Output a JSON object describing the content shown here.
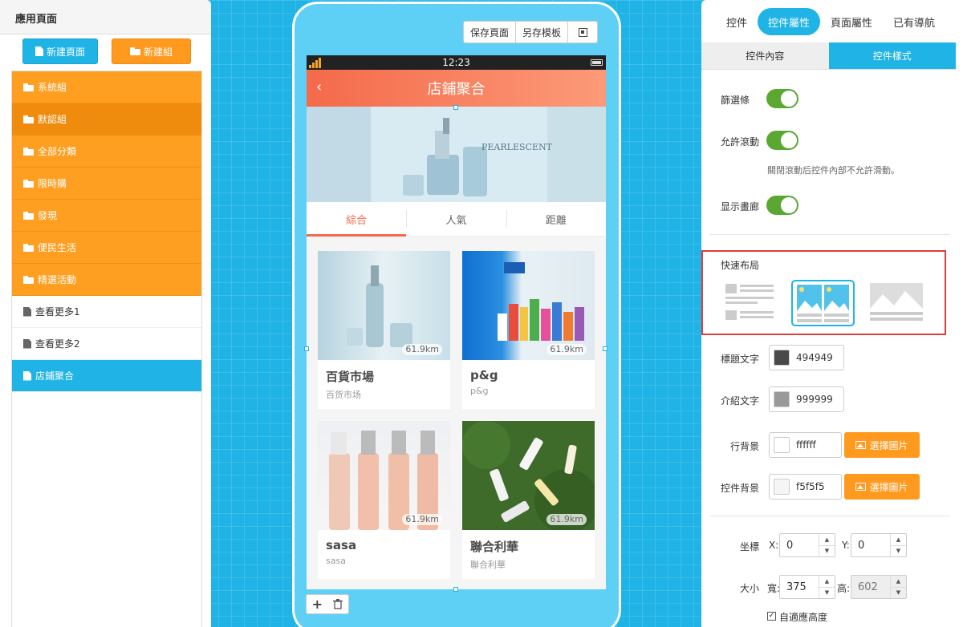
{
  "left": {
    "title": "應用頁面",
    "new_page": "新建頁面",
    "new_group": "新建組",
    "items": [
      {
        "label": "系統組",
        "type": "group"
      },
      {
        "label": "默認組",
        "type": "group"
      },
      {
        "label": "全部分類",
        "type": "group"
      },
      {
        "label": "限時購",
        "type": "group"
      },
      {
        "label": "發現",
        "type": "group"
      },
      {
        "label": "便民生活",
        "type": "group"
      },
      {
        "label": "精選活動",
        "type": "group"
      },
      {
        "label": "查看更多1",
        "type": "page"
      },
      {
        "label": "查看更多2",
        "type": "page"
      },
      {
        "label": "店鋪聚合",
        "type": "page"
      }
    ]
  },
  "toolbar": {
    "save": "保存頁面",
    "save_template": "另存模板",
    "qr_icon": "qrcode-icon"
  },
  "phone": {
    "time": "12:23",
    "title": "店鋪聚合",
    "back": "‹",
    "tabs": [
      "綜合",
      "人氣",
      "距離"
    ],
    "stores": [
      {
        "title": "百貨市場",
        "sub": "百货市场",
        "dist": "61.9km"
      },
      {
        "title": "p&g",
        "sub": "p&g",
        "dist": "61.9km"
      },
      {
        "title": "sasa",
        "sub": "sasa",
        "dist": "61.9km"
      },
      {
        "title": "聯合利華",
        "sub": "聯合利華",
        "dist": "61.9km"
      }
    ],
    "banner_text": "PEARLESCENT"
  },
  "bottombar": {
    "add": "+",
    "delete_icon": "trash-icon"
  },
  "right": {
    "tabs": [
      "控件",
      "控件屬性",
      "頁面屬性",
      "已有導航"
    ],
    "subtabs": [
      "控件內容",
      "控件樣式"
    ],
    "filter": "篩選條",
    "scroll": "允許滾動",
    "scroll_hint": "關閉滾動后控件內部不允許滑動。",
    "gallery": "显示畫廊",
    "quick_layout": "快速布局",
    "title_color_label": "標題文字",
    "title_color": "494949",
    "desc_color_label": "介紹文字",
    "desc_color": "999999",
    "row_bg_label": "行背景",
    "row_bg": "ffffff",
    "ctrl_bg_label": "控件背景",
    "ctrl_bg": "f5f5f5",
    "pick_image": "選擇圖片",
    "coord_label": "坐標",
    "x_label": "X:",
    "x": "0",
    "y_label": "Y:",
    "y": "0",
    "size_label": "大小",
    "w_label": "寬:",
    "w": "375",
    "h_label": "高:",
    "h": "602",
    "auto_height": "自適應高度"
  },
  "colors": {
    "accent": "#1fb3e6",
    "orange": "#ff9a1f",
    "nav": "#f46a4a",
    "toggle": "#5aa832",
    "highlight": "#e03c3c"
  }
}
